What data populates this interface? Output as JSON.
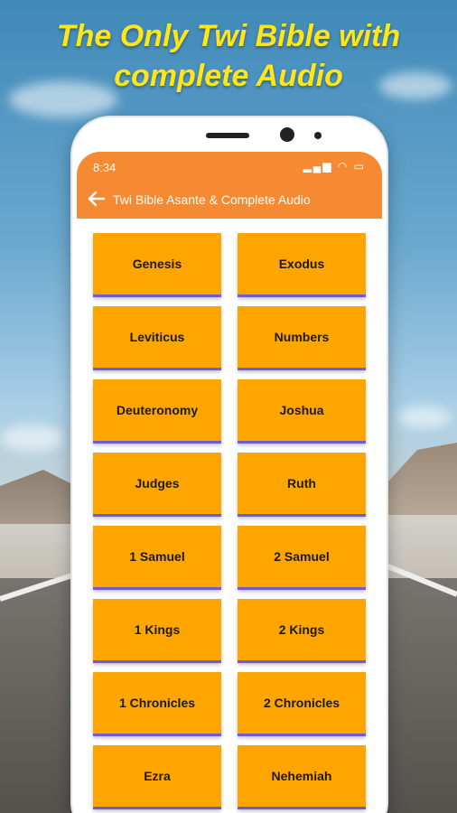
{
  "headline": {
    "line1": "The Only Twi Bible with",
    "line2": "complete Audio"
  },
  "status_bar": {
    "time": "8:34",
    "icons": "▂▄▆ ◠ ▭"
  },
  "app_bar": {
    "back_icon": "arrow-left",
    "title": "Twi Bible Asante & Complete Audio"
  },
  "books": [
    "Genesis",
    "Exodus",
    "Leviticus",
    "Numbers",
    "Deuteronomy",
    "Joshua",
    "Judges",
    "Ruth",
    "1 Samuel",
    "2 Samuel",
    "1 Kings",
    "2 Kings",
    "1 Chronicles",
    "2 Chronicles",
    "Ezra",
    "Nehemiah"
  ],
  "colors": {
    "headline": "#ffe61a",
    "app_bar": "#f58a33",
    "book_tile": "#ffa500",
    "tile_shadow": "#6f5bd6"
  }
}
